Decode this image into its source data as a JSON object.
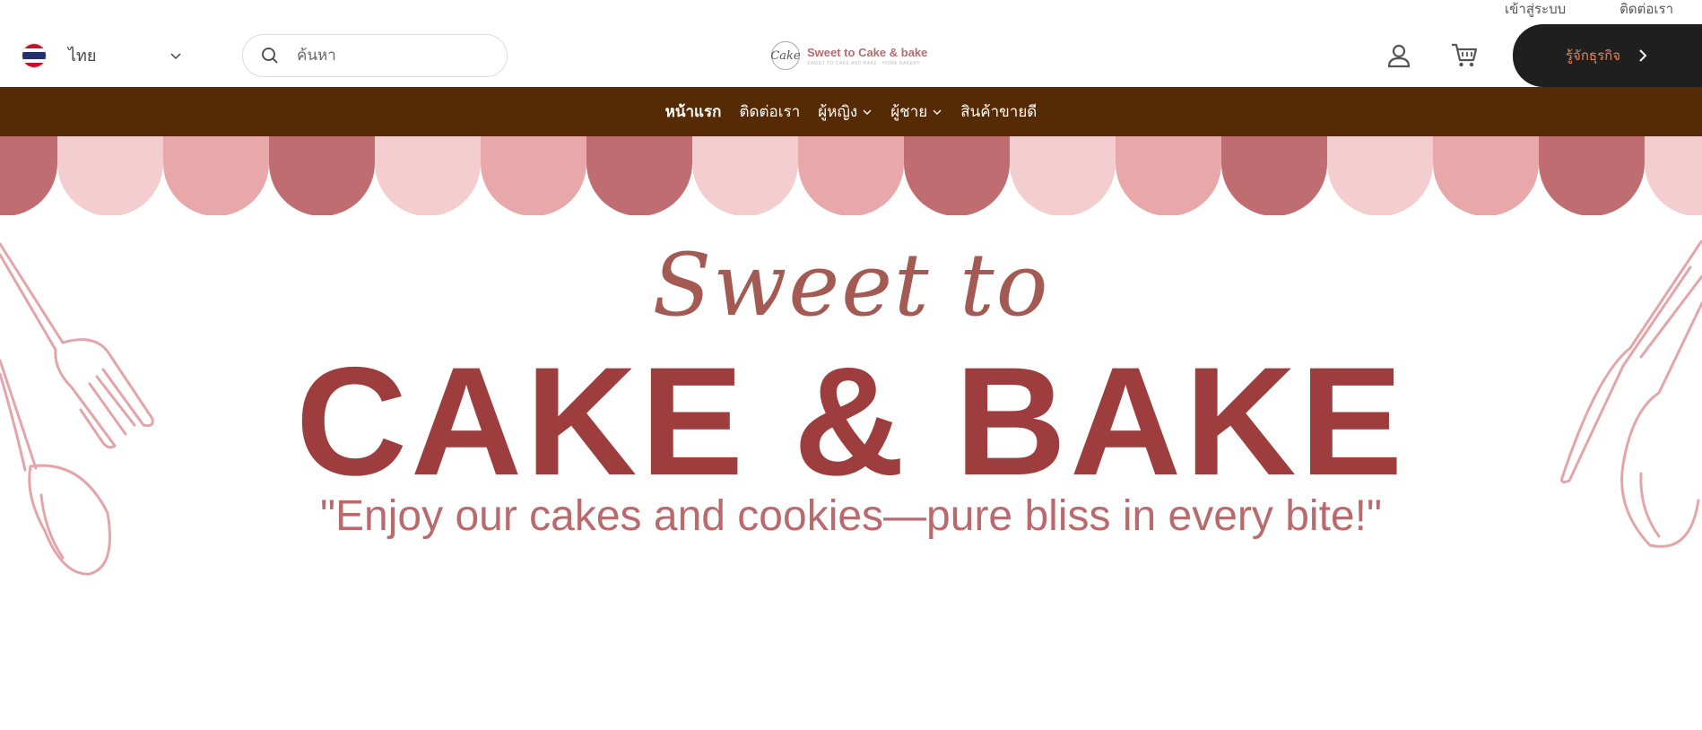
{
  "top_links": {
    "login": "เข้าสู่ระบบ",
    "contact": "ติดต่อเรา"
  },
  "language": {
    "label": "ไทย",
    "flag": "thai-flag-icon"
  },
  "search": {
    "placeholder": "ค้นหา",
    "value": ""
  },
  "logo": {
    "mark": "Cake",
    "name": "Sweet to Cake & bake",
    "tagline": "SWEET TO CAKE AND BAKE · HOME BAKERY"
  },
  "cta": {
    "label": "รู้จักธุรกิจ"
  },
  "nav": {
    "home": "หน้าแรก",
    "contact": "ติดต่อเรา",
    "women": "ผู้หญิง",
    "men": "ผู้ชาย",
    "bestsellers": "สินค้าขายดี"
  },
  "hero": {
    "script": "Sweet to",
    "title": "CAKE & BAKE",
    "quote": "\"Enjoy our cakes and cookies—pure bliss in every bite!\""
  },
  "colors": {
    "nav_bg": "#562a05",
    "cta_bg": "#1f1f1f",
    "cta_text": "#e0865a",
    "title": "#9e3d3d",
    "awning_dark": "#c06d72",
    "awning_mid": "#e8a8a9",
    "awning_light": "#f3cdd0"
  }
}
